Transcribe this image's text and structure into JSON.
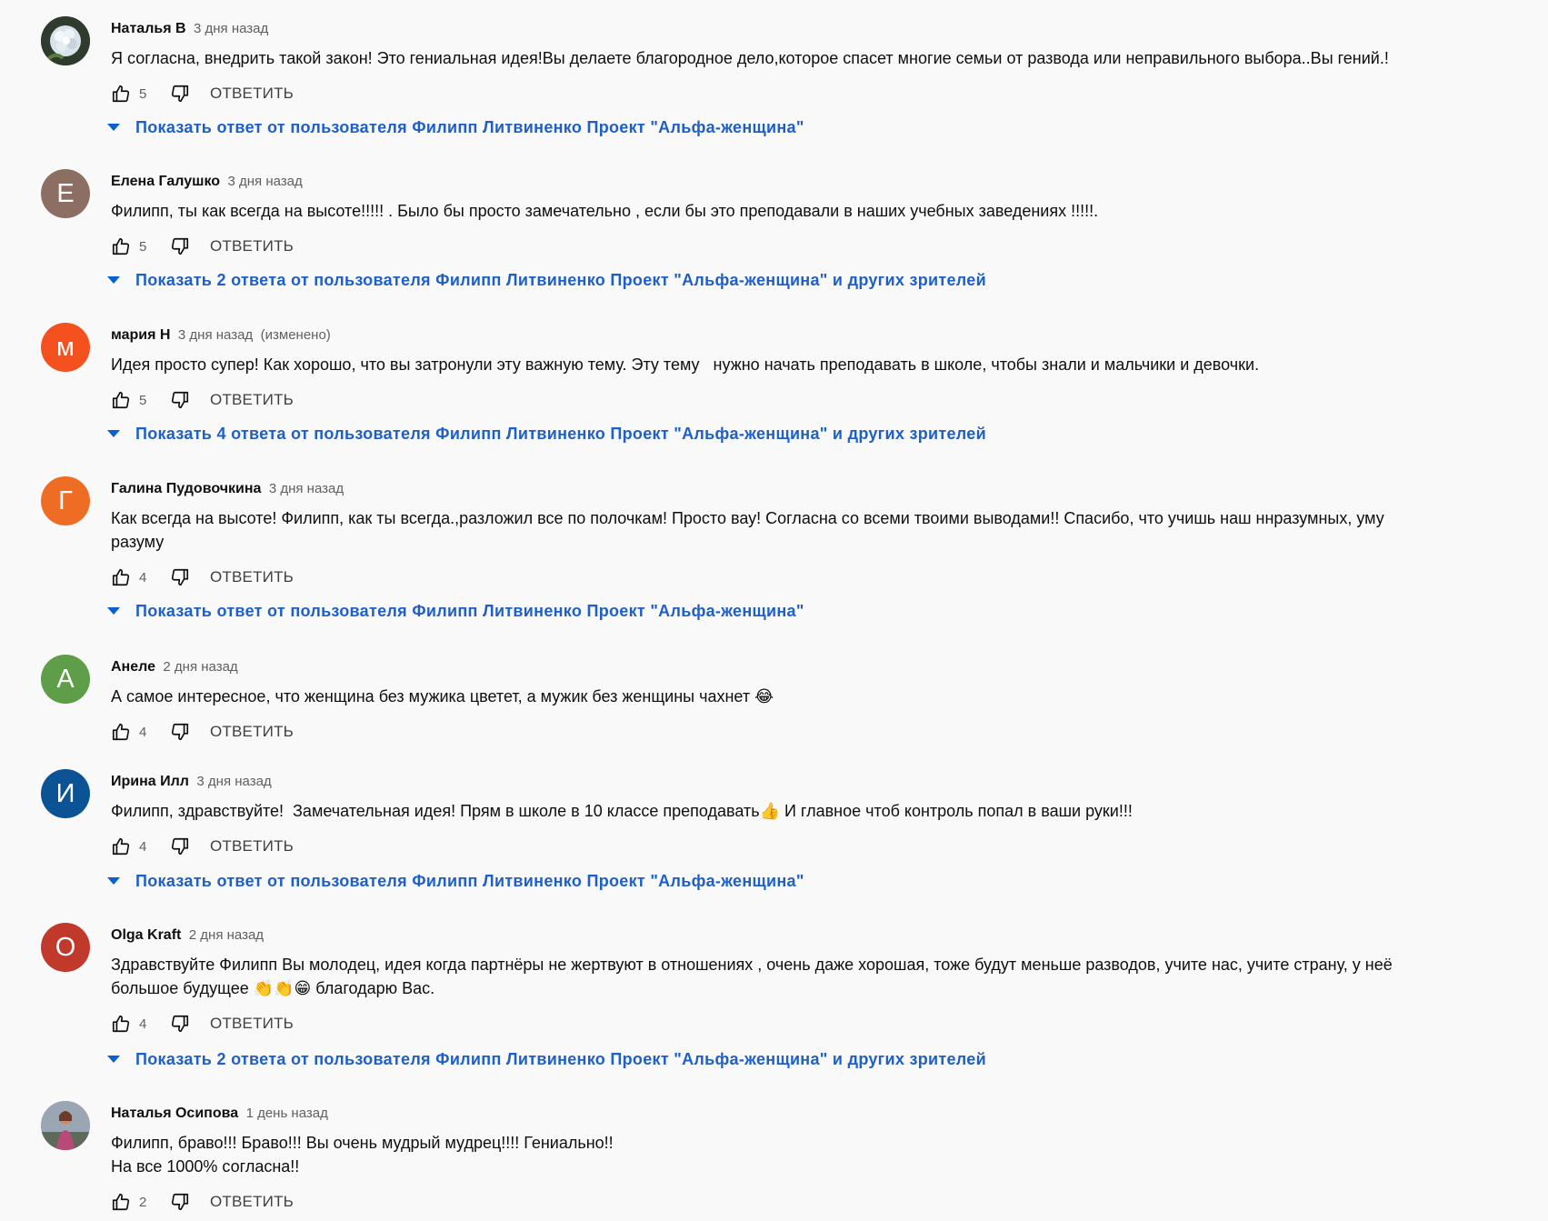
{
  "comments": [
    {
      "author": "Наталья В",
      "time": "3 дня назад",
      "edited": "",
      "avatar": {
        "letter": "",
        "color": "#3b4a3a",
        "icon": "hydrangea-photo"
      },
      "text": [
        "Я согласна, внедрить такой закон! Это гениальная идея!Вы делаете благородное дело,которое спасет многие семьи от развода или неправильного выбора..Вы гений.!"
      ],
      "likes": "5",
      "reply": "ОТВЕТИТЬ",
      "replies_label": "Показать ответ от пользователя Филипп Литвиненко Проект \"Альфа-женщина\""
    },
    {
      "author": "Елена Галушко",
      "time": "3 дня назад",
      "edited": "",
      "avatar": {
        "letter": "Е",
        "color": "#8d6e63",
        "icon": ""
      },
      "text": [
        "Филипп, ты как всегда на высоте!!!!! . Было бы просто замечательно , если бы это преподавали в наших учебных заведениях !!!!!."
      ],
      "likes": "5",
      "reply": "ОТВЕТИТЬ",
      "replies_label": "Показать 2 ответа от пользователя Филипп Литвиненко Проект \"Альфа-женщина\" и других зрителей"
    },
    {
      "author": "мария Н",
      "time": "3 дня назад",
      "edited": "(изменено)",
      "avatar": {
        "letter": "м",
        "color": "#f4511e",
        "icon": ""
      },
      "text": [
        "Идея просто супер! Как хорошо, что вы затронули эту важную тему. Эту тему   нужно начать преподавать в школе, чтобы знали и мальчики и девочки."
      ],
      "likes": "5",
      "reply": "ОТВЕТИТЬ",
      "replies_label": "Показать 4 ответа от пользователя Филипп Литвиненко Проект \"Альфа-женщина\" и других зрителей"
    },
    {
      "author": "Галина Пудовочкина",
      "time": "3 дня назад",
      "edited": "",
      "avatar": {
        "letter": "Г",
        "color": "#ef6c24",
        "icon": ""
      },
      "text": [
        "Как всегда на высоте! Филипп, как ты всегда.,разложил все по полочкам! Просто вау! Согласна со всеми твоими выводами!! Спасибо, что учишь наш ннразумных, уму",
        "разуму"
      ],
      "likes": "4",
      "reply": "ОТВЕТИТЬ",
      "replies_label": "Показать ответ от пользователя Филипп Литвиненко Проект \"Альфа-женщина\""
    },
    {
      "author": "Анеле",
      "time": "2 дня назад",
      "edited": "",
      "avatar": {
        "letter": "А",
        "color": "#5e9e48",
        "icon": ""
      },
      "text": [
        "А самое интересное, что женщина без мужика цветет, а мужик без женщины чахнет 😂"
      ],
      "likes": "4",
      "reply": "ОТВЕТИТЬ",
      "replies_label": ""
    },
    {
      "author": "Ирина Илл",
      "time": "3 дня назад",
      "edited": "",
      "avatar": {
        "letter": "И",
        "color": "#0b5394",
        "icon": ""
      },
      "text": [
        "Филипп, здравствуйте!  Замечательная идея! Прям в школе в 10 классе преподавать👍 И главное чтоб контроль попал в ваши руки!!!"
      ],
      "likes": "4",
      "reply": "ОТВЕТИТЬ",
      "replies_label": "Показать ответ от пользователя Филипп Литвиненко Проект \"Альфа-женщина\""
    },
    {
      "author": "Olga Kraft",
      "time": "2 дня назад",
      "edited": "",
      "avatar": {
        "letter": "O",
        "color": "#c0392b",
        "icon": ""
      },
      "text": [
        "Здравствуйте Филипп Вы молодец, идея когда партнёры не жертвуют в отношениях , очень даже хорошая, тоже будут меньше разводов, учите нас, учите страну, у неё",
        "большое будущее 👏👏😁 благодарю Вас."
      ],
      "likes": "4",
      "reply": "ОТВЕТИТЬ",
      "replies_label": "Показать 2 ответа от пользователя Филипп Литвиненко Проект \"Альфа-женщина\" и других зрителей"
    },
    {
      "author": "Наталья Осипова",
      "time": "1 день назад",
      "edited": "",
      "avatar": {
        "letter": "",
        "color": "#8f9aa8",
        "icon": "person-photo"
      },
      "text": [
        "Филипп, браво!!! Браво!!! Вы очень мудрый мудрец!!!! Гениально!!",
        "На все 1000% согласна!!"
      ],
      "likes": "2",
      "reply": "ОТВЕТИТЬ",
      "replies_label": ""
    }
  ],
  "icons": {
    "like": "thumbs-up-icon",
    "dislike": "thumbs-down-icon",
    "expand": "caret-down-icon"
  },
  "colors": {
    "link": "#065fd4",
    "secondary_text": "#606060",
    "background": "#f9f9f9"
  }
}
